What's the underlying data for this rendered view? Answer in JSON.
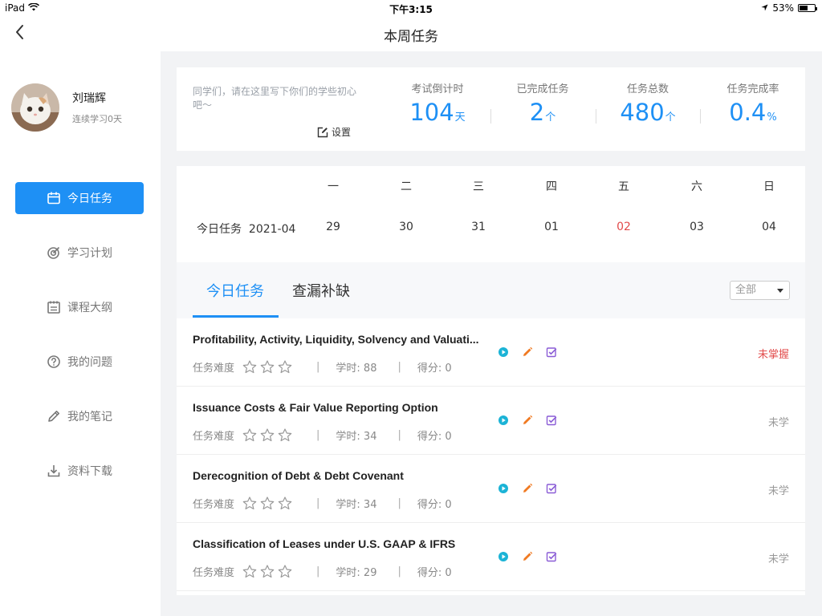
{
  "status_bar": {
    "device": "iPad",
    "time": "下午3:15",
    "battery_text": "53%",
    "battery_level": 0.53
  },
  "nav": {
    "title": "本周任务"
  },
  "profile": {
    "name": "刘瑞辉",
    "streak": "连续学习0天"
  },
  "sidebar": {
    "items": [
      {
        "label": "今日任务",
        "icon": "calendar-icon",
        "active": true
      },
      {
        "label": "学习计划",
        "icon": "target-icon",
        "active": false
      },
      {
        "label": "课程大纲",
        "icon": "syllabus-icon",
        "active": false
      },
      {
        "label": "我的问题",
        "icon": "question-icon",
        "active": false
      },
      {
        "label": "我的笔记",
        "icon": "pencil-icon",
        "active": false
      },
      {
        "label": "资料下载",
        "icon": "download-icon",
        "active": false
      }
    ]
  },
  "stats": {
    "motto": "同学们，请在这里写下你们的学些初心吧～",
    "settings_label": "设置",
    "items": [
      {
        "label": "考试倒计时",
        "value": "104",
        "unit": "天"
      },
      {
        "label": "已完成任务",
        "value": "2",
        "unit": "个"
      },
      {
        "label": "任务总数",
        "value": "480",
        "unit": "个"
      },
      {
        "label": "任务完成率",
        "value": "0.4",
        "unit": "%"
      }
    ]
  },
  "week": {
    "label": "今日任务",
    "month": "2021-04",
    "weekdays": [
      "一",
      "二",
      "三",
      "四",
      "五",
      "六",
      "日"
    ],
    "dates": [
      "29",
      "30",
      "31",
      "01",
      "02",
      "03",
      "04"
    ],
    "today_index": 4,
    "today_color": "#e24b4b"
  },
  "tasks": {
    "tabs": [
      {
        "label": "今日任务",
        "active": true
      },
      {
        "label": "查漏补缺",
        "active": false
      }
    ],
    "filter": "全部",
    "difficulty_label": "任务难度",
    "rows": [
      {
        "title": "Profitability, Activity, Liquidity, Solvency and Valuati...",
        "hours": "学时: 88",
        "score": "得分: 0",
        "status": "未掌握",
        "status_red": true
      },
      {
        "title": "Issuance Costs & Fair Value Reporting Option",
        "hours": "学时: 34",
        "score": "得分: 0",
        "status": "未学",
        "status_red": false
      },
      {
        "title": "Derecognition of Debt & Debt Covenant",
        "hours": "学时: 34",
        "score": "得分: 0",
        "status": "未学",
        "status_red": false
      },
      {
        "title": "Classification of Leases under U.S. GAAP & IFRS",
        "hours": "学时: 29",
        "score": "得分: 0",
        "status": "未学",
        "status_red": false
      }
    ]
  },
  "colors": {
    "accent": "#1e90f5",
    "play": "#1bb3d6",
    "edit": "#f07a22",
    "check": "#8a5cd6",
    "danger": "#e24b4b"
  }
}
